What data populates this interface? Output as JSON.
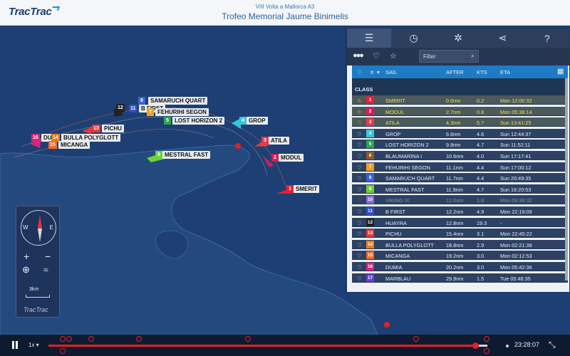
{
  "header": {
    "logo": "TracTrac",
    "subtitle": "VIII Volta a Mallorca A3",
    "title": "Trofeo Memorial Jaume Binimelis"
  },
  "map": {
    "labels": [
      {
        "num": "12",
        "name": "",
        "color": "#222222"
      },
      {
        "num": "8",
        "name": "SAMARUCH QUART",
        "color": "#3a63d6"
      },
      {
        "num": "11",
        "name": "B FIRST",
        "color": "#3150c8"
      },
      {
        "num": "7",
        "name": "FEHURIHI SEGON",
        "color": "#f0a020"
      },
      {
        "num": "5",
        "name": "LOST HORIZON 2",
        "color": "#2aa84a"
      },
      {
        "num": "4",
        "name": "GROP",
        "color": "#36c8d8"
      },
      {
        "num": "13",
        "name": "PICHU",
        "color": "#e23a3a"
      },
      {
        "num": "16",
        "name": "DU",
        "color": "#d8247a"
      },
      {
        "num": "14",
        "name": "BULLA POLYGLOTT",
        "color": "#f07a18"
      },
      {
        "num": "15",
        "name": "MICANGA",
        "color": "#f06a28"
      },
      {
        "num": "3",
        "name": "ATILA",
        "color": "#e63a48"
      },
      {
        "num": "9",
        "name": "MESTRAL FAST",
        "color": "#6cd23a"
      },
      {
        "num": "2",
        "name": "MODUL",
        "color": "#d61e5a"
      },
      {
        "num": "1",
        "name": "SMERIT",
        "color": "#e61f3a"
      }
    ],
    "compass": {
      "west": "W",
      "east": "E"
    },
    "zoom_in": "+",
    "zoom_out": "−",
    "scale": "3km",
    "widget_logo": "TracTrac"
  },
  "panel": {
    "tabs": [
      "leaderboard-icon",
      "stopwatch-icon",
      "settings-icon",
      "share-icon",
      "help-icon"
    ],
    "help_label": "?",
    "filter_placeholder": "Filter",
    "columns": {
      "num": "#",
      "sail": "SAIL",
      "after": "AFTER",
      "kts": "KTS",
      "eta": "ETA"
    },
    "class_label": "CLASS",
    "rows": [
      {
        "rank": "1",
        "sail": "SMERIT",
        "after": "0.0nm",
        "kts": "0.2",
        "eta": "Mon 12:00:32",
        "color": "#e61f3a",
        "highlight": true
      },
      {
        "rank": "2",
        "sail": "MODUL",
        "after": "2.7nm",
        "kts": "0.8",
        "eta": "Mon 05:38:14",
        "color": "#d61e5a",
        "highlight": true
      },
      {
        "rank": "3",
        "sail": "ATILA",
        "after": "4.3nm",
        "kts": "5.7",
        "eta": "Sun 13:41:25",
        "color": "#e63a48",
        "highlight": true
      },
      {
        "rank": "4",
        "sail": "GROP",
        "after": "6.6nm",
        "kts": "4.6",
        "eta": "Sun 12:44:37",
        "color": "#36c8d8"
      },
      {
        "rank": "5",
        "sail": "LOST HORIZON 2",
        "after": "9.8nm",
        "kts": "4.7",
        "eta": "Sun 11:52:11",
        "color": "#2aa84a"
      },
      {
        "rank": "6",
        "sail": "BLAUMARINA I",
        "after": "10.6nm",
        "kts": "4.0",
        "eta": "Sun 17:17:41",
        "color": "#8a5a2a"
      },
      {
        "rank": "7",
        "sail": "FEHURIHI SEGON",
        "after": "11.1nm",
        "kts": "4.4",
        "eta": "Sun 17:00:12",
        "color": "#f0a020"
      },
      {
        "rank": "8",
        "sail": "SAMARUCH QUART",
        "after": "11.7nm",
        "kts": "4.4",
        "eta": "Sun 20:49:35",
        "color": "#3a63d6"
      },
      {
        "rank": "9",
        "sail": "MESTRAL FAST",
        "after": "11.9nm",
        "kts": "4.7",
        "eta": "Sun 16:20:53",
        "color": "#6cd23a"
      },
      {
        "rank": "10",
        "sail": "VIKING IX",
        "after": "12.0nm",
        "kts": "1.8",
        "eta": "Mon 09:38:32",
        "color": "#8a6ad6",
        "dim": true
      },
      {
        "rank": "11",
        "sail": "B FIRST",
        "after": "12.2nm",
        "kts": "4.9",
        "eta": "Mon 22:19:09",
        "color": "#3150c8"
      },
      {
        "rank": "12",
        "sail": "HUAYRA",
        "after": "12.8nm",
        "kts": "19.3",
        "eta": "-",
        "color": "#222222"
      },
      {
        "rank": "13",
        "sail": "PICHU",
        "after": "15.4nm",
        "kts": "3.1",
        "eta": "Mon 22:45:22",
        "color": "#e23a3a"
      },
      {
        "rank": "14",
        "sail": "BULLA POLYGLOTT",
        "after": "18.8nm",
        "kts": "2.9",
        "eta": "Mon 02:21:38",
        "color": "#f07a18"
      },
      {
        "rank": "15",
        "sail": "MICANGA",
        "after": "19.2nm",
        "kts": "3.0",
        "eta": "Mon 02:12:53",
        "color": "#f06a28"
      },
      {
        "rank": "16",
        "sail": "DUMIA",
        "after": "20.2nm",
        "kts": "3.0",
        "eta": "Mon 05:42:36",
        "color": "#d8247a"
      },
      {
        "rank": "17",
        "sail": "MARBLAU",
        "after": "29.9nm",
        "kts": "1.5",
        "eta": "Tue 05:46:35",
        "color": "#6a3ad6"
      }
    ]
  },
  "timeline": {
    "speed": "1x",
    "progress": 0.97,
    "time": "23:28:07"
  }
}
